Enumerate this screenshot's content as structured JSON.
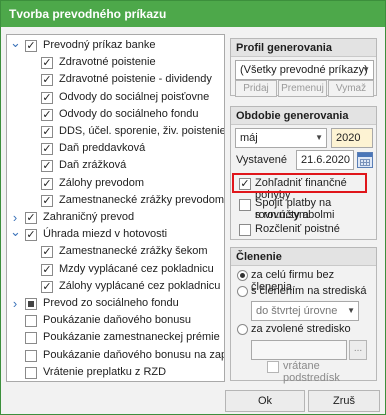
{
  "window": {
    "title": "Tvorba prevodného príkazu"
  },
  "tree": {
    "items": [
      {
        "label": "Prevodný príkaz banke",
        "level": 0,
        "expander": "v",
        "check": "checked"
      },
      {
        "label": "Zdravotné poistenie",
        "level": 1,
        "expander": "",
        "check": "checked"
      },
      {
        "label": "Zdravotné poistenie - dividendy",
        "level": 1,
        "expander": "",
        "check": "checked"
      },
      {
        "label": "Odvody do sociálnej poisťovne",
        "level": 1,
        "expander": "",
        "check": "checked"
      },
      {
        "label": "Odvody do sociálneho fondu",
        "level": 1,
        "expander": "",
        "check": "checked"
      },
      {
        "label": "DDS, účel. sporenie, živ. poistenie",
        "level": 1,
        "expander": "",
        "check": "checked"
      },
      {
        "label": "Daň preddavková",
        "level": 1,
        "expander": "",
        "check": "checked"
      },
      {
        "label": "Daň zrážková",
        "level": 1,
        "expander": "",
        "check": "checked"
      },
      {
        "label": "Zálohy prevodom",
        "level": 1,
        "expander": "",
        "check": "checked"
      },
      {
        "label": "Zamestnanecké zrážky prevodom",
        "level": 1,
        "expander": "",
        "check": "checked"
      },
      {
        "label": "Zahraničný prevod",
        "level": 0,
        "expander": ">",
        "check": "checked"
      },
      {
        "label": "Úhrada miezd v hotovosti",
        "level": 0,
        "expander": "v",
        "check": "checked"
      },
      {
        "label": "Zamestnanecké zrážky šekom",
        "level": 1,
        "expander": "",
        "check": "checked"
      },
      {
        "label": "Mzdy vyplácané cez pokladnicu",
        "level": 1,
        "expander": "",
        "check": "checked"
      },
      {
        "label": "Zálohy vyplácané cez pokladnicu",
        "level": 1,
        "expander": "",
        "check": "checked"
      },
      {
        "label": "Prevod zo sociálneho fondu",
        "level": 0,
        "expander": ">",
        "check": "partial"
      },
      {
        "label": "Poukázanie daňového bonusu",
        "level": 0,
        "expander": "",
        "check": "empty"
      },
      {
        "label": "Poukázanie zamestnaneckej prémie",
        "level": 0,
        "expander": "",
        "check": "empty"
      },
      {
        "label": "Poukázanie daňového bonusu na zapl...",
        "level": 0,
        "expander": "",
        "check": "empty"
      },
      {
        "label": "Vrátenie preplatku z RZD",
        "level": 0,
        "expander": "",
        "check": "empty"
      }
    ]
  },
  "profile": {
    "title": "Profil generovania",
    "selected": "(Všetky prevodné príkazy)",
    "buttons": [
      "Pridaj",
      "Premenuj",
      "Vymaž"
    ]
  },
  "period": {
    "title": "Obdobie generovania",
    "month": "máj",
    "year": "2020",
    "issued_label": "Vystavené",
    "issued_date": "21.6.2020",
    "options": [
      {
        "label": "Zohľadniť finančné pohyby",
        "checked": true
      },
      {
        "label_line1": "Spojiť platby na rovn.účty a",
        "label_line2": "s rovn.symbolmi",
        "checked": false
      },
      {
        "label": "Rozčleniť poistné",
        "checked": false
      }
    ]
  },
  "division": {
    "title": "Členenie",
    "radios": [
      {
        "label": "za celú firmu bez členenia",
        "selected": true
      },
      {
        "label": "s členením na strediská",
        "selected": false
      },
      {
        "label": "za zvolené stredisko",
        "selected": false
      }
    ],
    "level_select": "do štvrtej úrovne",
    "include_sub_label": "vrátane podstredísk",
    "browse_label": "..."
  },
  "footer": {
    "ok": "Ok",
    "cancel": "Zruš"
  },
  "colors": {
    "title_bar": "#4da84a",
    "highlight_border": "#e0161b",
    "accent": "#3b73b9"
  }
}
